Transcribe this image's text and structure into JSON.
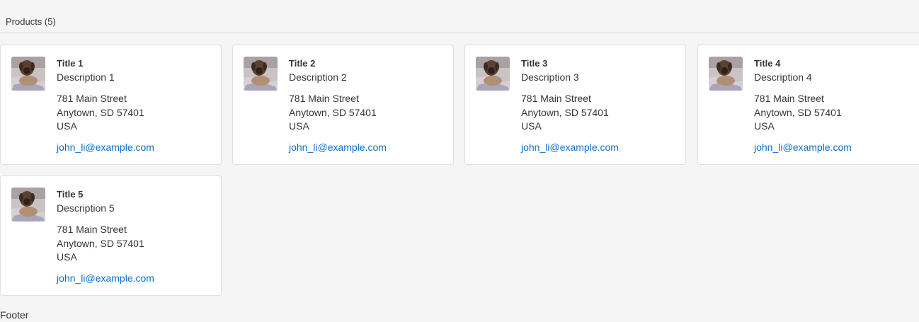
{
  "toolbar": {
    "title": "Products (5)"
  },
  "cards": [
    {
      "title": "Title 1",
      "description": "Description 1",
      "street": "781 Main Street",
      "city": "Anytown, SD 57401",
      "country": "USA",
      "email": "john_li@example.com",
      "image": "dog-photo"
    },
    {
      "title": "Title 2",
      "description": "Description 2",
      "street": "781 Main Street",
      "city": "Anytown, SD 57401",
      "country": "USA",
      "email": "john_li@example.com",
      "image": "dog-photo"
    },
    {
      "title": "Title 3",
      "description": "Description 3",
      "street": "781 Main Street",
      "city": "Anytown, SD 57401",
      "country": "USA",
      "email": "john_li@example.com",
      "image": "dog-photo"
    },
    {
      "title": "Title 4",
      "description": "Description 4",
      "street": "781 Main Street",
      "city": "Anytown, SD 57401",
      "country": "USA",
      "email": "john_li@example.com",
      "image": "dog-photo"
    },
    {
      "title": "Title 5",
      "description": "Description 5",
      "street": "781 Main Street",
      "city": "Anytown, SD 57401",
      "country": "USA",
      "email": "john_li@example.com",
      "image": "dog-photo"
    }
  ],
  "footer": {
    "label": "Footer"
  },
  "colors": {
    "link": "#0a6ed1",
    "text": "#32363a",
    "background": "#f5f5f5",
    "card": "#ffffff"
  }
}
